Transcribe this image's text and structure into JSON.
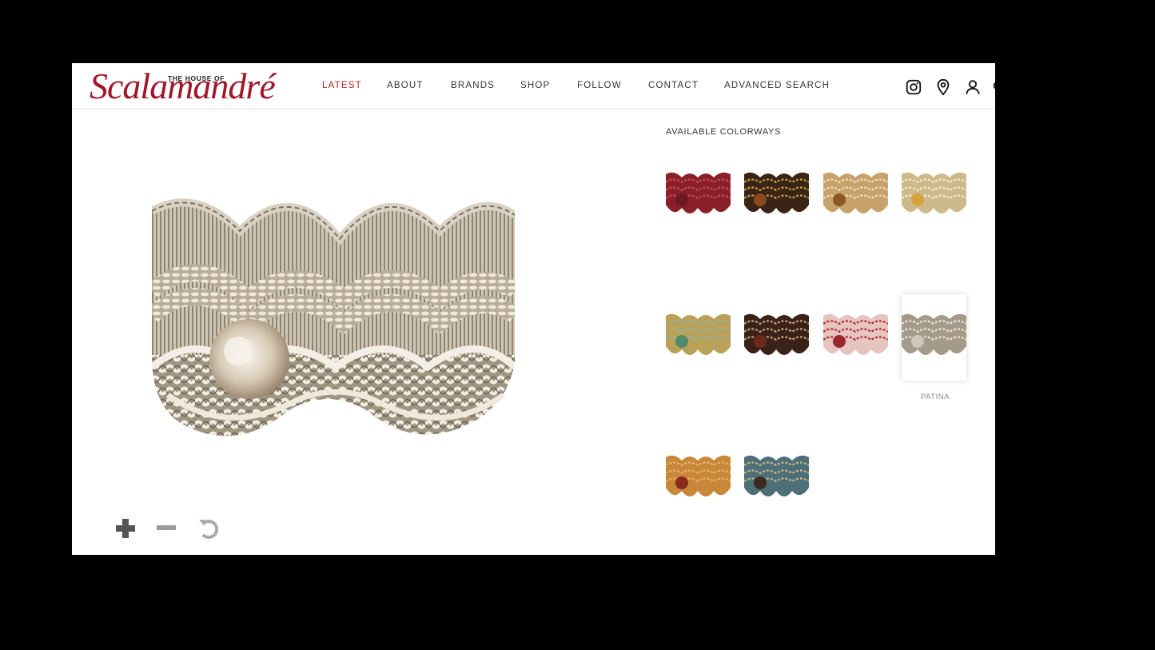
{
  "header": {
    "logo": {
      "top_text": "THE HOUSE OF",
      "script_text": "Scalamandré"
    },
    "nav": [
      {
        "label": "LATEST",
        "active": true
      },
      {
        "label": "ABOUT",
        "active": false
      },
      {
        "label": "BRANDS",
        "active": false
      },
      {
        "label": "SHOP",
        "active": false
      },
      {
        "label": "FOLLOW",
        "active": false
      },
      {
        "label": "CONTACT",
        "active": false
      },
      {
        "label": "ADVANCED SEARCH",
        "active": false
      }
    ],
    "icons": [
      "instagram-icon",
      "location-pin-icon",
      "user-icon",
      "search-icon"
    ]
  },
  "viewer": {
    "controls": [
      "zoom-in-icon",
      "zoom-out-icon",
      "reset-icon"
    ]
  },
  "colorways": {
    "heading": "AVAILABLE COLORWAYS",
    "selected_label": "PATINA",
    "swatches": [
      {
        "color": "#8a1f2a",
        "accent": "#b8535b",
        "center": "#6b1a20"
      },
      {
        "color": "#3a2416",
        "accent": "#c79a4a",
        "center": "#8a4a1c"
      },
      {
        "color": "#c7a26b",
        "accent": "#efe0c0",
        "center": "#8a5a22"
      },
      {
        "color": "#cdb98a",
        "accent": "#f3ecd6",
        "center": "#d9a13c"
      },
      {
        "color": "#b9a15a",
        "accent": "#8fb3a7",
        "center": "#4f8a6a"
      },
      {
        "color": "#3a2218",
        "accent": "#c9a27a",
        "center": "#6b2a1c"
      },
      {
        "color": "#e6c4c0",
        "accent": "#b32a35",
        "center": "#9a2a30"
      },
      {
        "color": "#a59a8a",
        "accent": "#e9e4da",
        "center": "#cfc7bb",
        "selected": true
      },
      {
        "color": "#c9873a",
        "accent": "#e6b46a",
        "center": "#8a2a1a"
      },
      {
        "color": "#4d6f78",
        "accent": "#c6b583",
        "center": "#3a2a20"
      }
    ]
  }
}
